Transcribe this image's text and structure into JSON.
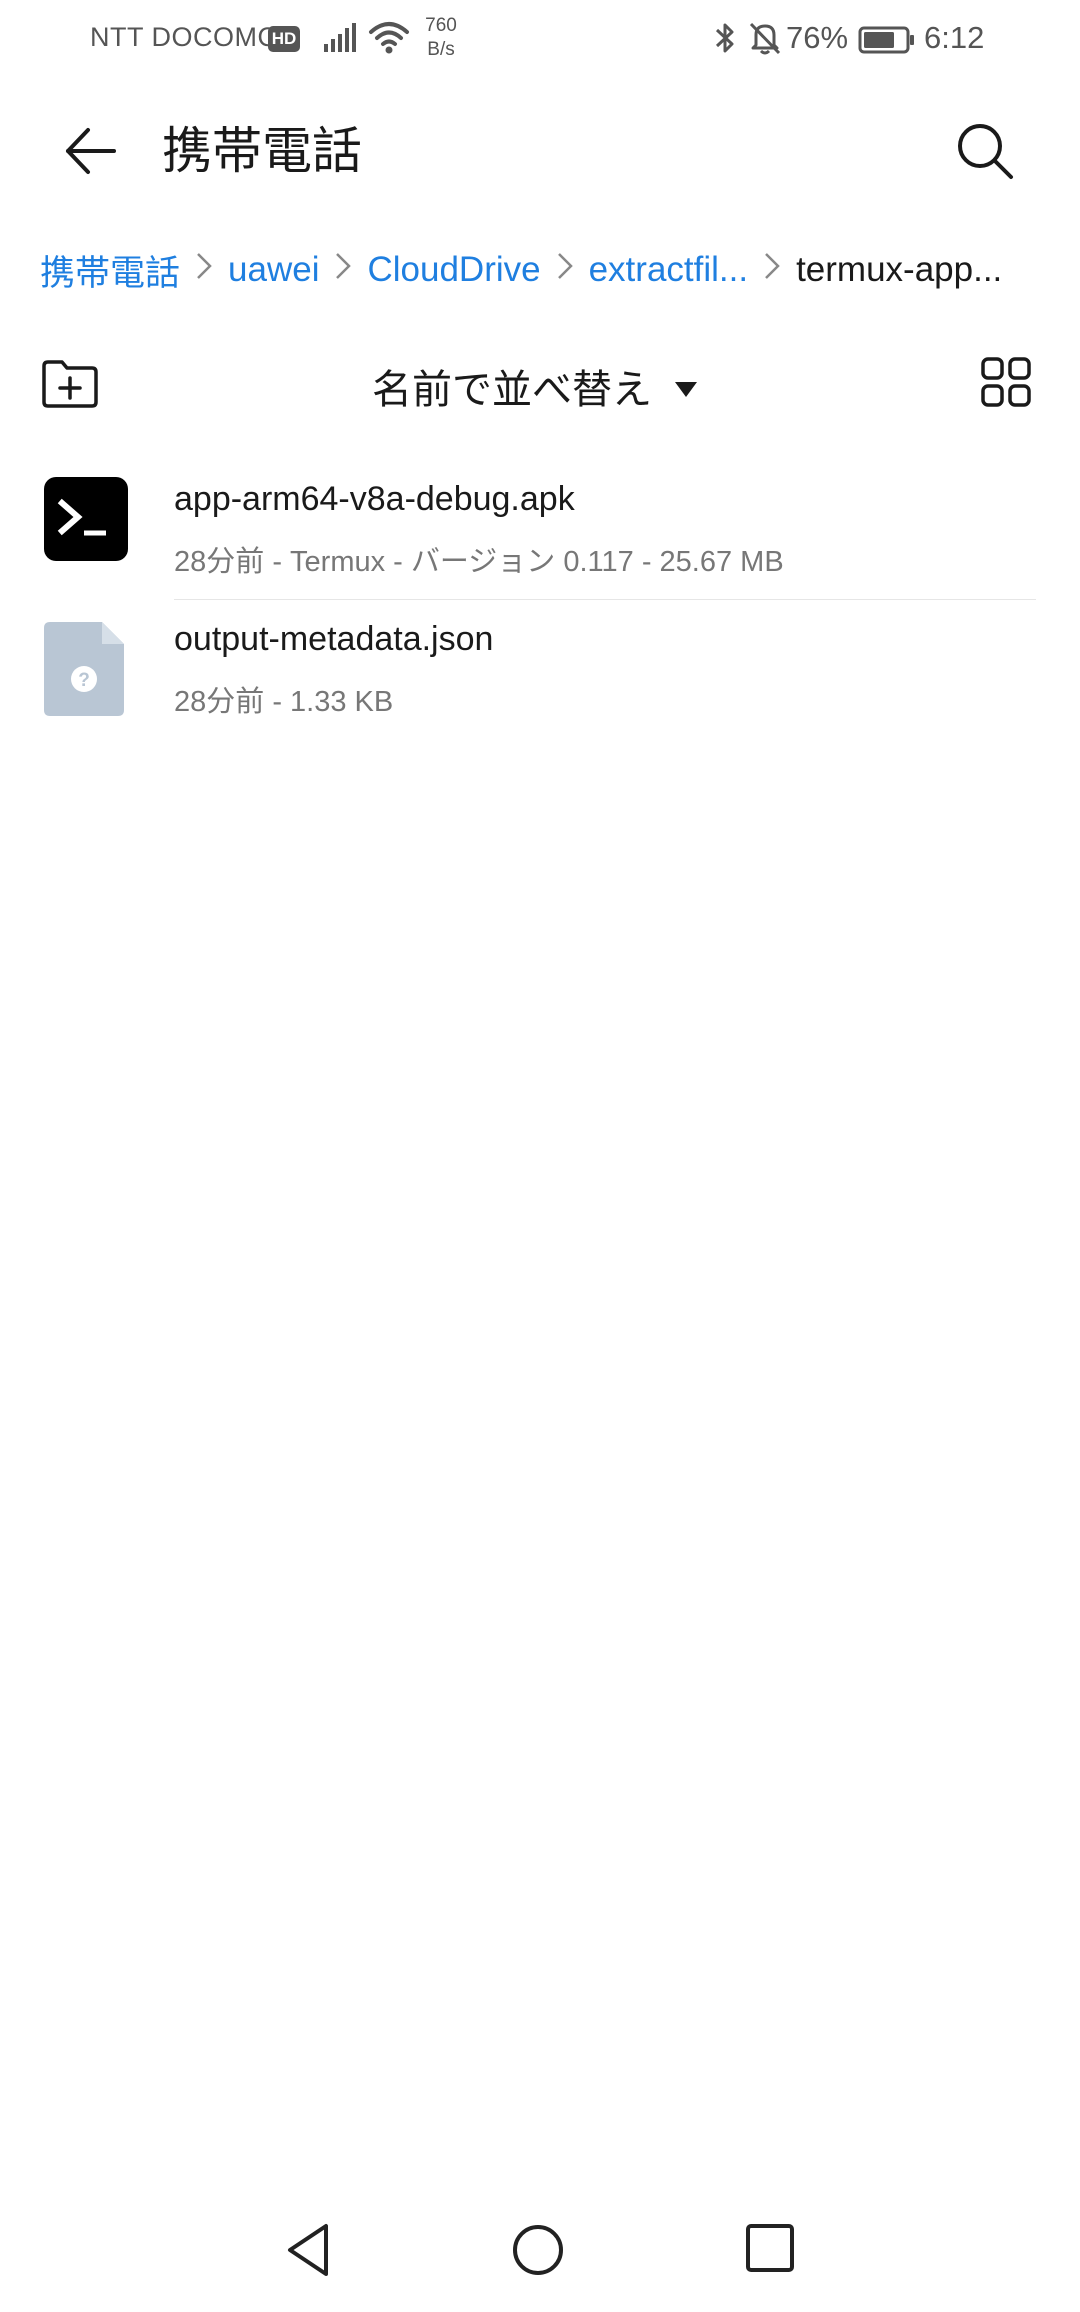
{
  "status_bar": {
    "carrier": "NTT DOCOMO",
    "hd_badge": "HD",
    "net_speed_value": "760",
    "net_speed_unit": "B/s",
    "battery": "76%",
    "time": "6:12",
    "icons": [
      "signal-icon",
      "wifi-icon",
      "bluetooth-icon",
      "bell-off-icon",
      "battery-icon"
    ]
  },
  "header": {
    "title": "携帯電話"
  },
  "breadcrumb": [
    {
      "label": "携帯電話"
    },
    {
      "label": "uawei"
    },
    {
      "label": "CloudDrive"
    },
    {
      "label": "extractfil..."
    },
    {
      "label": "termux-app..."
    }
  ],
  "toolbar": {
    "sort_label": "名前で並べ替え"
  },
  "files": [
    {
      "name": "app-arm64-v8a-debug.apk",
      "meta": "28分前 - Termux - バージョン 0.117 - 25.67 MB",
      "icon": "termux-app-icon"
    },
    {
      "name": "output-metadata.json",
      "meta": "28分前 - 1.33 KB",
      "icon": "unknown-file-icon"
    }
  ],
  "colors": {
    "accent": "#1f7fe0",
    "text": "#1a1a1a",
    "secondary_text": "#777777",
    "file_icon_gray": "#b9c6d4"
  }
}
